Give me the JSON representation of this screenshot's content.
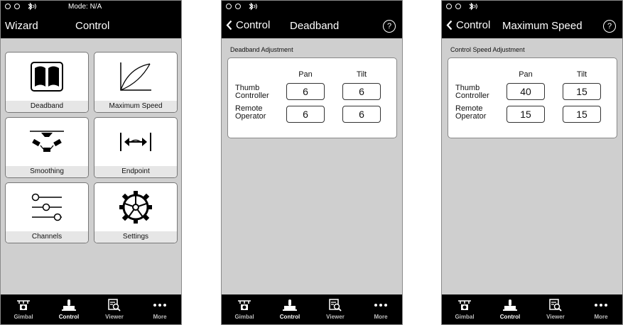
{
  "status": {
    "mode_text": "Mode: N/A"
  },
  "tabs": [
    {
      "label": "Gimbal",
      "icon": "gimbal-icon"
    },
    {
      "label": "Control",
      "icon": "joystick-icon"
    },
    {
      "label": "Viewer",
      "icon": "viewer-icon"
    },
    {
      "label": "More",
      "icon": "more-icon"
    }
  ],
  "screen1": {
    "nav_left": "Wizard",
    "nav_title": "Control",
    "tiles": [
      {
        "label": "Deadband",
        "icon": "deadband-icon"
      },
      {
        "label": "Maximum Speed",
        "icon": "speed-curve-icon"
      },
      {
        "label": "Smoothing",
        "icon": "smoothing-icon"
      },
      {
        "label": "Endpoint",
        "icon": "endpoint-icon"
      },
      {
        "label": "Channels",
        "icon": "sliders-icon"
      },
      {
        "label": "Settings",
        "icon": "gear-icon"
      }
    ]
  },
  "screen2": {
    "back_label": "Control",
    "nav_title": "Deadband",
    "help": "?",
    "section_label": "Deadband Adjustment",
    "columns": [
      "Pan",
      "Tilt"
    ],
    "rows": [
      {
        "label_line1": "Thumb",
        "label_line2": "Controller",
        "pan": "6",
        "tilt": "6"
      },
      {
        "label_line1": "Remote",
        "label_line2": "Operator",
        "pan": "6",
        "tilt": "6"
      }
    ]
  },
  "screen3": {
    "back_label": "Control",
    "nav_title": "Maximum Speed",
    "help": "?",
    "section_label": "Control Speed Adjustment",
    "columns": [
      "Pan",
      "Tilt"
    ],
    "rows": [
      {
        "label_line1": "Thumb",
        "label_line2": "Controller",
        "pan": "40",
        "tilt": "15"
      },
      {
        "label_line1": "Remote",
        "label_line2": "Operator",
        "pan": "15",
        "tilt": "15"
      }
    ]
  }
}
